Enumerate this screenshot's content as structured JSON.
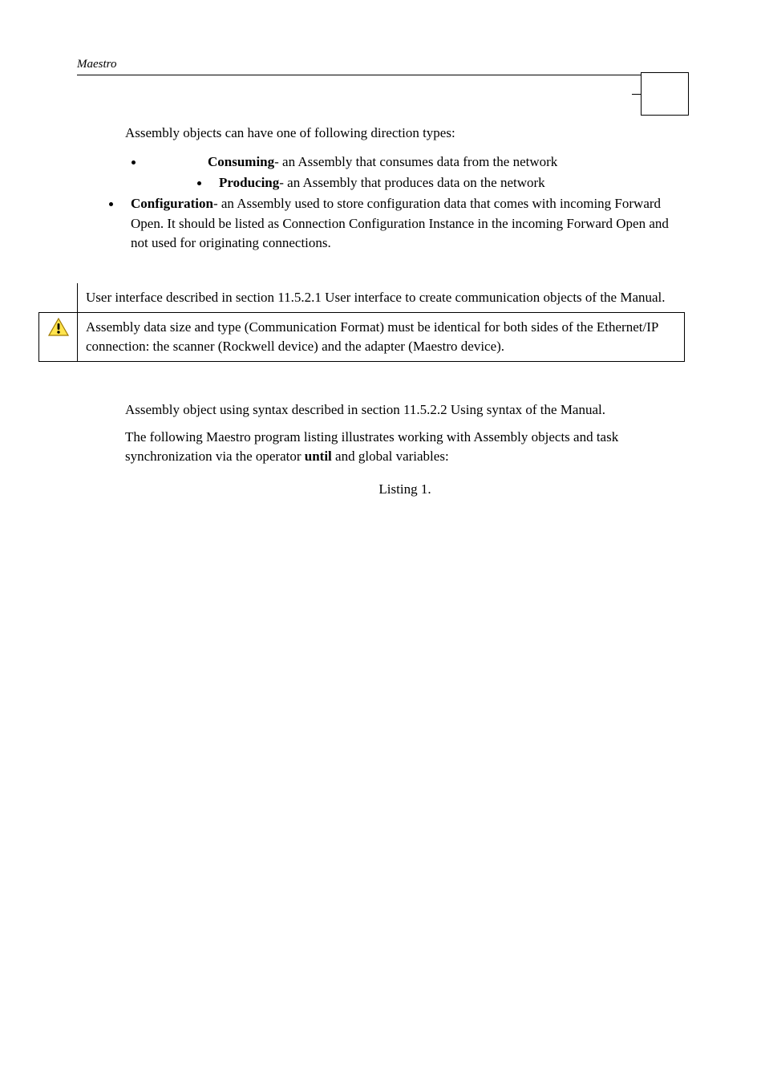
{
  "header": {
    "title": "Maestro"
  },
  "intro": "Assembly objects can have one of following direction types:",
  "bullets": {
    "b1_label": "Consuming",
    "b1_rest": "- an Assembly that consumes data from the network",
    "b2_label": "Producing",
    "b2_rest": "- an Assembly that produces data on the network",
    "b3_label": "Configuration",
    "b3_rest": "- an Assembly used to store configuration data that comes with incoming Forward Open. It should be listed as Connection Configuration Instance in the incoming Forward Open and not used for originating connections."
  },
  "note_top": "User interface described in section 11.5.2.1 User interface to create communication objects of the Manual.",
  "note_warn": "Assembly data size and type (Communication Format) must be identical for both sides of the Ethernet/IP connection: the scanner (Rockwell device) and the adapter (Maestro device).",
  "para2": "Assembly object using syntax described in section 11.5.2.2 Using syntax of the Manual.",
  "para3_pre": "The following Maestro program listing illustrates working with Assembly objects and task synchronization via the operator ",
  "para3_bold": "until",
  "para3_post": " and global variables:",
  "listing": "Listing 1."
}
